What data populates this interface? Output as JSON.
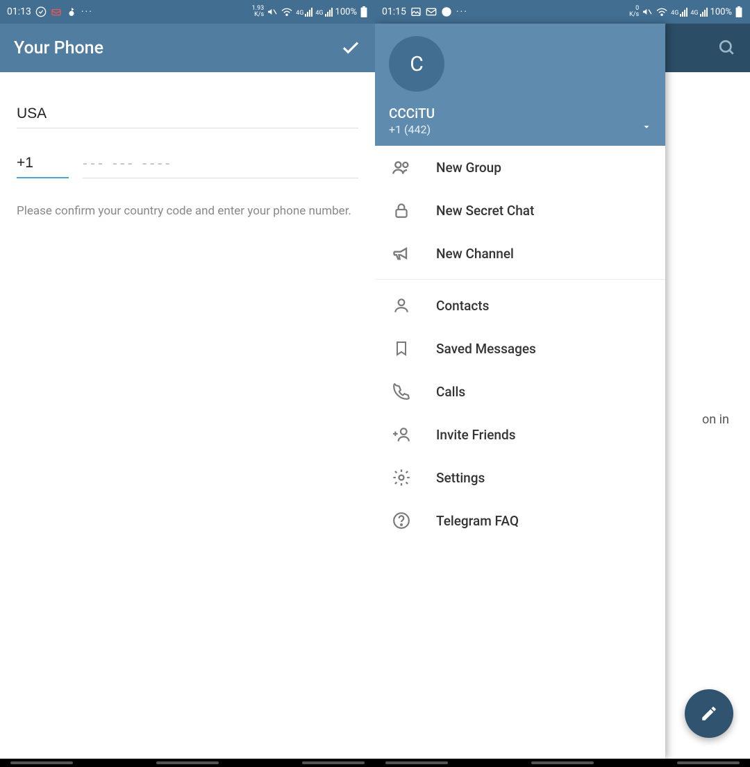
{
  "left": {
    "statusbar": {
      "time": "01:13",
      "net": "1.93",
      "netUnit": "K/s",
      "battery": "100%",
      "sig": "4G"
    },
    "header": {
      "title": "Your Phone"
    },
    "form": {
      "country": "USA",
      "code": "+1",
      "phonePlaceholder": "--- --- ----",
      "helper": "Please confirm your country code and enter your phone number."
    }
  },
  "right": {
    "statusbar": {
      "time": "01:15",
      "net": "0",
      "netUnit": "K/s",
      "battery": "100%",
      "sig": "4G"
    },
    "bg": {
      "text": "on in"
    },
    "drawer": {
      "avatar": "C",
      "name": "CCCiTU",
      "phone": "+1 (442)",
      "items1": [
        {
          "label": "New Group",
          "icon": "group"
        },
        {
          "label": "New Secret Chat",
          "icon": "lock"
        },
        {
          "label": "New Channel",
          "icon": "megaphone"
        }
      ],
      "items2": [
        {
          "label": "Contacts",
          "icon": "contact"
        },
        {
          "label": "Saved Messages",
          "icon": "bookmark"
        },
        {
          "label": "Calls",
          "icon": "call"
        },
        {
          "label": "Invite Friends",
          "icon": "invite"
        },
        {
          "label": "Settings",
          "icon": "gear"
        },
        {
          "label": "Telegram FAQ",
          "icon": "help"
        }
      ]
    }
  }
}
